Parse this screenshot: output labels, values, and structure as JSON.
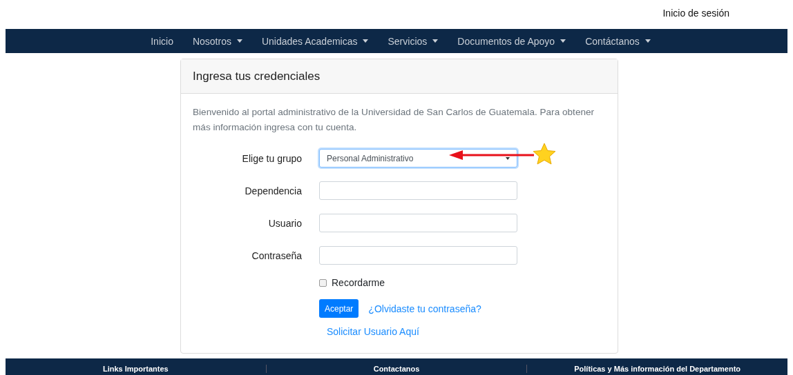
{
  "top_bar": {
    "login_link": "Inicio de sesión"
  },
  "nav": [
    {
      "label": "Inicio",
      "dropdown": false
    },
    {
      "label": "Nosotros",
      "dropdown": true
    },
    {
      "label": "Unidades Academicas",
      "dropdown": true
    },
    {
      "label": "Servicios",
      "dropdown": true
    },
    {
      "label": "Documentos de Apoyo",
      "dropdown": true
    },
    {
      "label": "Contáctanos",
      "dropdown": true
    }
  ],
  "card": {
    "title": "Ingresa tus credenciales",
    "intro": "Bienvenido al portal administrativo de la Universidad de San Carlos de Guatemala. Para obtener más información ingresa con tu cuenta.",
    "fields": [
      {
        "label": "Elige tu grupo",
        "kind": "select",
        "value": "Personal Administrativo",
        "focused": true
      },
      {
        "label": "Dependencia",
        "kind": "text",
        "focused": false
      },
      {
        "label": "Usuario",
        "kind": "text",
        "focused": false
      },
      {
        "label": "Contraseña",
        "kind": "password",
        "focused": false
      }
    ],
    "remember": {
      "label": "Recordarme",
      "checked": false
    },
    "submit": "Aceptar",
    "forgot_link": "¿Olvidaste tu contraseña?",
    "request_link": "Solicitar Usuario Aquí"
  },
  "footer": {
    "columns": [
      "Links Importantes",
      "Contactanos",
      "Políticas y Más información del Departamento"
    ]
  }
}
